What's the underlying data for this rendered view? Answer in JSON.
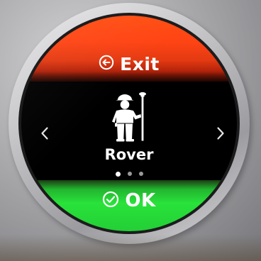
{
  "exit": {
    "label": "Exit",
    "icon": "exit-arrow-icon",
    "color": "#ff4a14"
  },
  "mode": {
    "label": "Rover",
    "icon": "rover-surveyor-icon"
  },
  "pager": {
    "count": 3,
    "active_index": 0
  },
  "ok": {
    "label": "OK",
    "icon": "check-circle-icon",
    "color": "#29e23a"
  },
  "navigation": {
    "prev_icon": "chevron-left-icon",
    "next_icon": "chevron-right-icon"
  }
}
